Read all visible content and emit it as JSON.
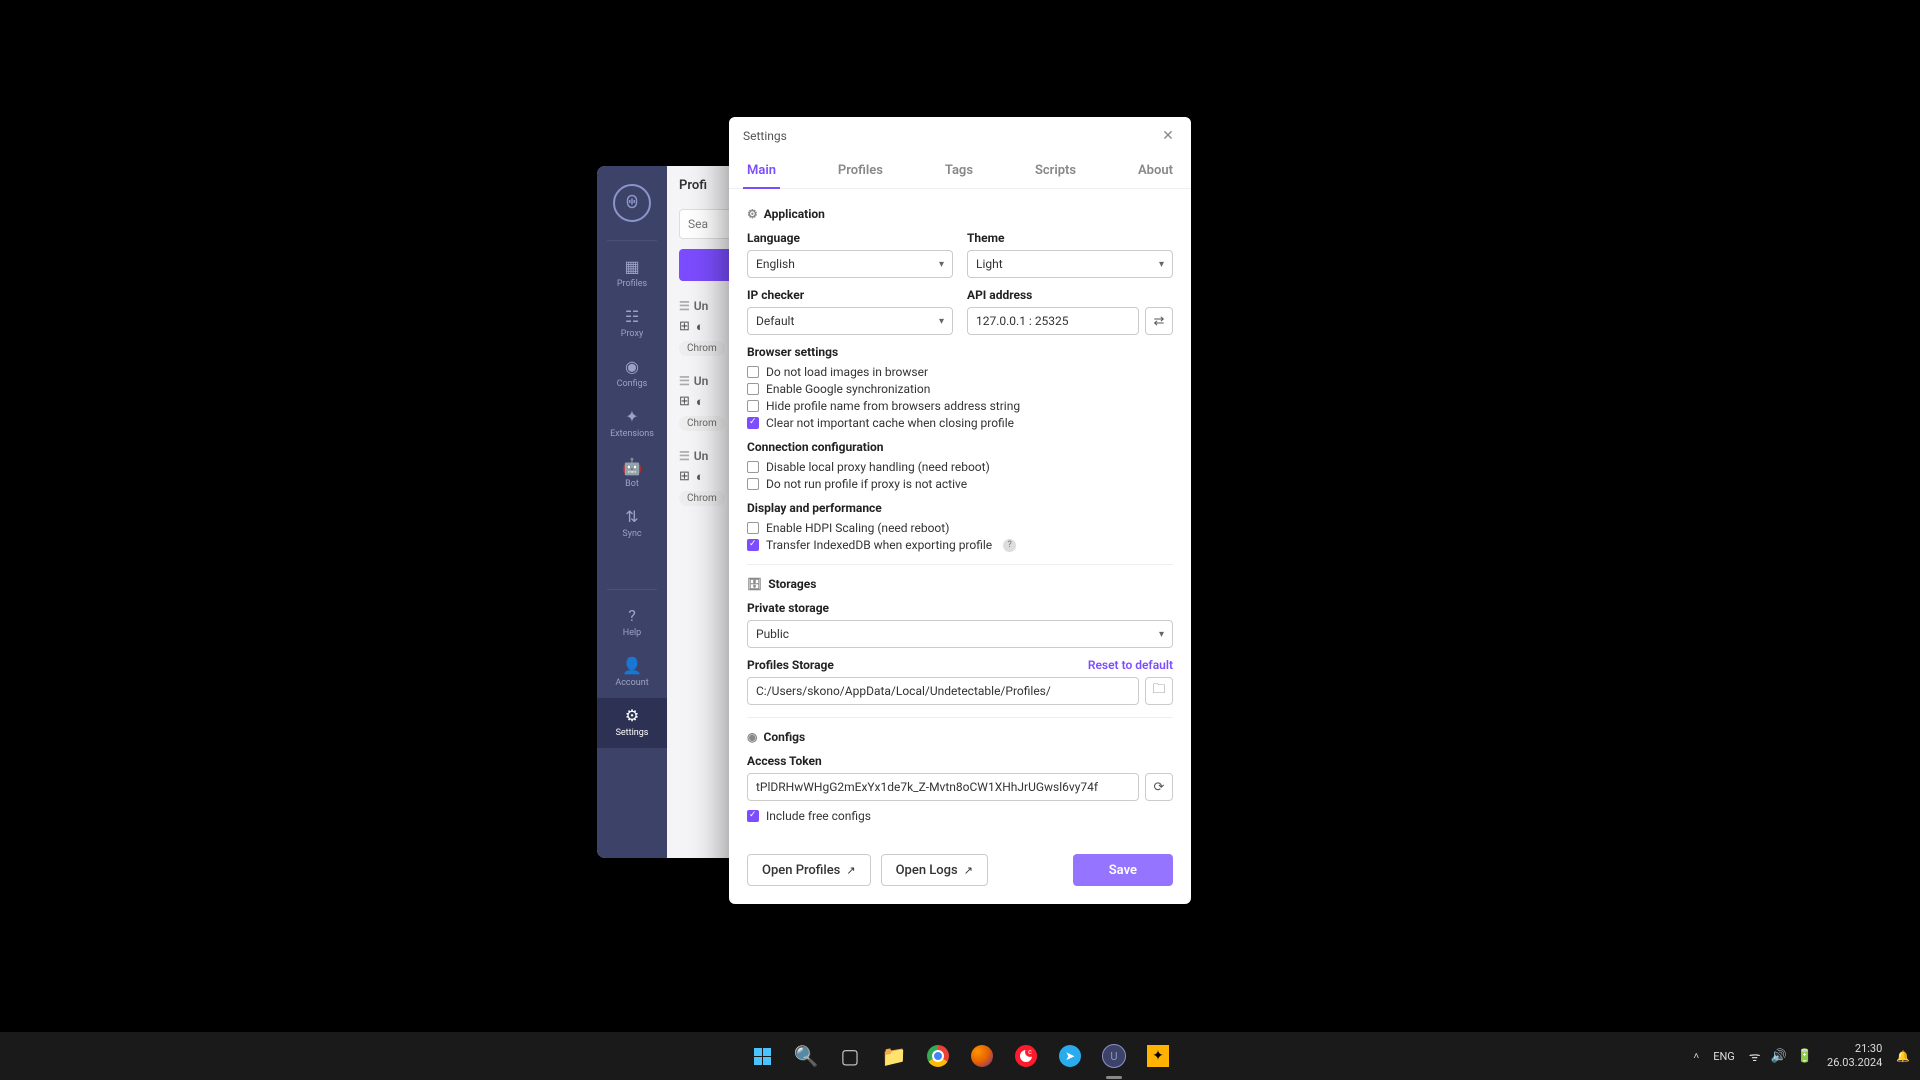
{
  "bgWindow": {
    "tabLabel": "Profi",
    "searchPlaceholder": "Sea",
    "nav": {
      "profiles": "Profiles",
      "proxy": "Proxy",
      "configs": "Configs",
      "extensions": "Extensions",
      "bot": "Bot",
      "sync": "Sync",
      "help": "Help",
      "account": "Account",
      "settings": "Settings"
    },
    "profileRows": [
      {
        "title": "Un",
        "chip": "Chrom"
      },
      {
        "title": "Un",
        "chip": "Chrom"
      },
      {
        "title": "Un",
        "chip": "Chrom"
      }
    ]
  },
  "modal": {
    "title": "Settings",
    "tabs": {
      "main": "Main",
      "profiles": "Profiles",
      "tags": "Tags",
      "scripts": "Scripts",
      "about": "About"
    },
    "sections": {
      "application": "Application",
      "storages": "Storages",
      "configs": "Configs"
    },
    "app": {
      "languageLabel": "Language",
      "languageValue": "English",
      "themeLabel": "Theme",
      "themeValue": "Light",
      "ipCheckerLabel": "IP checker",
      "ipCheckerValue": "Default",
      "apiLabel": "API address",
      "apiValue": "127.0.0.1 : 25325"
    },
    "browserSettings": {
      "title": "Browser settings",
      "opt1": "Do not load images in browser",
      "opt2": "Enable Google synchronization",
      "opt3": "Hide profile name from browsers address string",
      "opt4": "Clear not important cache when closing profile"
    },
    "connection": {
      "title": "Connection configuration",
      "opt1": "Disable local proxy handling (need reboot)",
      "opt2": "Do not run profile if proxy is not active"
    },
    "display": {
      "title": "Display and performance",
      "opt1": "Enable HDPI Scaling (need reboot)",
      "opt2": "Transfer IndexedDB when exporting profile"
    },
    "storage": {
      "privateLabel": "Private storage",
      "privateValue": "Public",
      "profilesStorageLabel": "Profiles Storage",
      "resetLink": "Reset to default",
      "profilesPath": "C:/Users/skono/AppData/Local/Undetectable/Profiles/"
    },
    "configs": {
      "tokenLabel": "Access Token",
      "tokenValue": "tPlDRHwWHgG2mExYx1de7k_Z-Mvtn8oCW1XHhJrUGwsl6vy74f",
      "includeFree": "Include free configs"
    },
    "footer": {
      "openProfiles": "Open Profiles",
      "openLogs": "Open Logs",
      "save": "Save"
    }
  },
  "taskbar": {
    "lang": "ENG",
    "time": "21:30",
    "date": "26.03.2024"
  }
}
